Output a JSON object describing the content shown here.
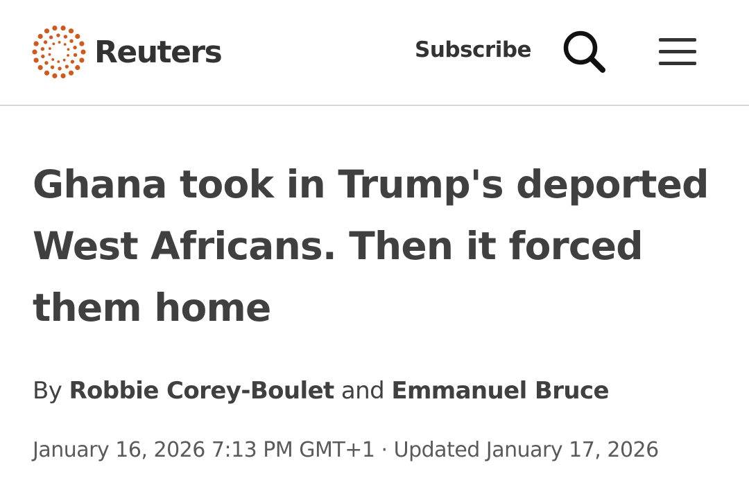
{
  "header": {
    "brand": "Reuters",
    "brand_color": "#d05a1e",
    "subscribe_label": "Subscribe",
    "search_icon": "search-icon",
    "menu_icon": "hamburger-menu-icon"
  },
  "article": {
    "headline": "Ghana took in Trump's deported West Africans. Then it forced them home",
    "byline": {
      "prefix": "By",
      "author1": "Robbie Corey-Boulet",
      "conjunction": "and",
      "author2": "Emmanuel Bruce"
    },
    "published": "January 16, 2026 7:13 PM GMT+1",
    "separator": "·",
    "updated": "Updated January 17, 2026"
  }
}
